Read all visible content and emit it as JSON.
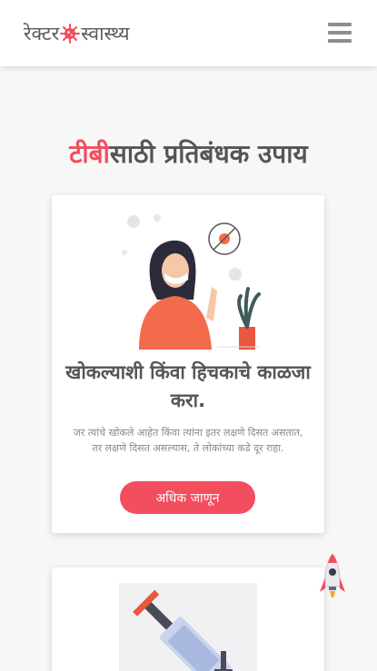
{
  "header": {
    "logo_part1": "रेक्टर",
    "logo_part2": "स्वास्थ्य",
    "logo_icon": "virus-icon",
    "menu_icon": "hamburger-menu-icon"
  },
  "page": {
    "title_accent": "टीबी",
    "title_rest": "साठी प्रतिबंधक उपाय"
  },
  "cards": [
    {
      "title": "खोकल्याशी किंवा हिचकाचे काळजा करा.",
      "text": "जर त्यांचे खोकले आहेत किंवा त्यांना इतर लक्षणे दिसत असतात, तर लक्षणे दिसत असल्यास, ते लोकांच्या कडे दूर राहा.",
      "button_label": "अधिक जाणून",
      "illustration": "woman-with-mask-illustration"
    },
    {
      "illustration": "vaccine-syringe-illustration"
    }
  ],
  "scroll_top_icon": "rocket-icon",
  "colors": {
    "accent": "#f24e5e",
    "text": "#555555",
    "muted": "#8a8a8a",
    "background": "#f7f7f8"
  }
}
